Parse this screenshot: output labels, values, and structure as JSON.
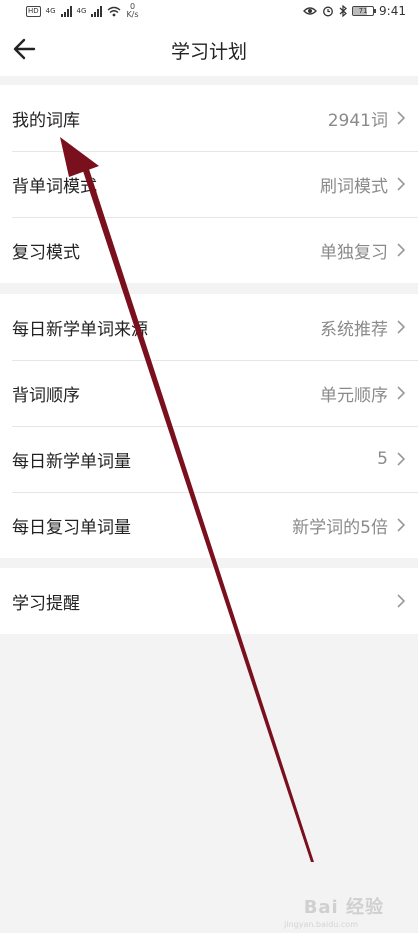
{
  "status_bar": {
    "hd": "HD",
    "net1": "4G",
    "net2": "4G",
    "speed_value": "0",
    "speed_unit": "K/s",
    "battery": "71",
    "battery_level": 0.71,
    "time": "9:41"
  },
  "header": {
    "title": "学习计划"
  },
  "groups": [
    {
      "rows": [
        {
          "label": "我的词库",
          "value": "2941词"
        },
        {
          "label": "背单词模式",
          "value": "刷词模式"
        },
        {
          "label": "复习模式",
          "value": "单独复习"
        }
      ]
    },
    {
      "rows": [
        {
          "label": "每日新学单词来源",
          "value": "系统推荐"
        },
        {
          "label": "背词顺序",
          "value": "单元顺序"
        },
        {
          "label": "每日新学单词量",
          "value": "5"
        },
        {
          "label": "每日复习单词量",
          "value": "新学词的5倍"
        }
      ]
    },
    {
      "rows": [
        {
          "label": "学习提醒",
          "value": ""
        }
      ]
    }
  ],
  "watermark": {
    "brand": "Bai 经验",
    "sub": "jingyan.baidu.com"
  },
  "colors": {
    "annotation_arrow": "#7a0f1e",
    "divider": "#e6e6e6",
    "value_text": "#8a8a8a"
  }
}
